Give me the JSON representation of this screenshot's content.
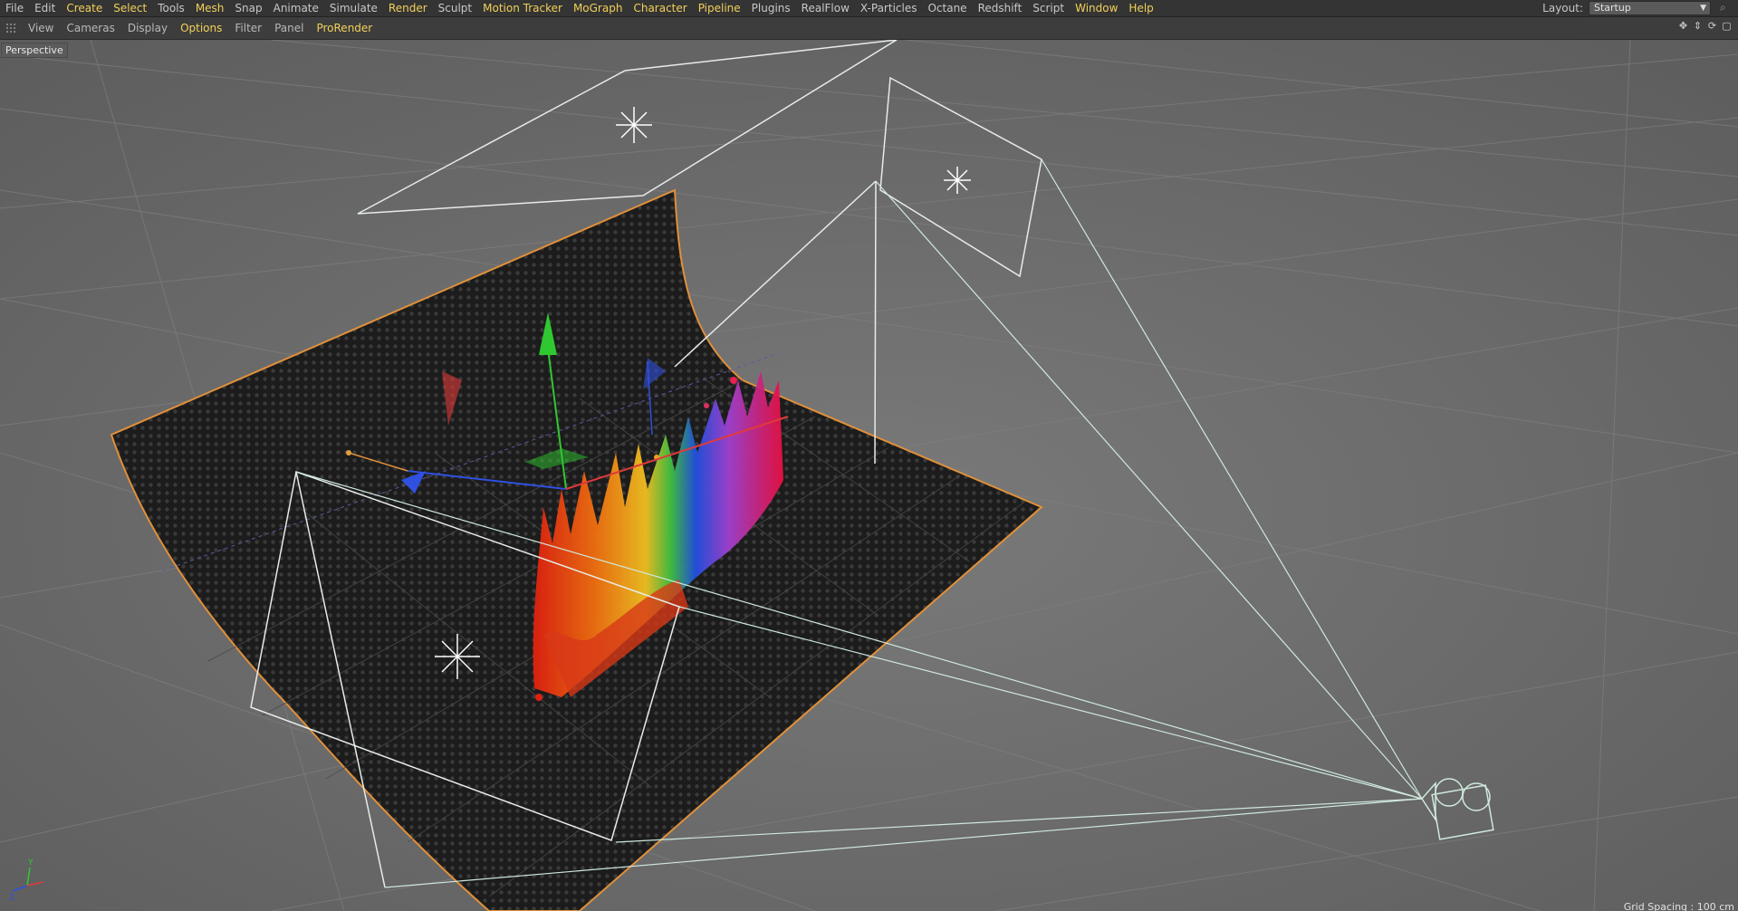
{
  "menubar": {
    "items": [
      {
        "label": "File",
        "hl": false
      },
      {
        "label": "Edit",
        "hl": false
      },
      {
        "label": "Create",
        "hl": true
      },
      {
        "label": "Select",
        "hl": true
      },
      {
        "label": "Tools",
        "hl": false
      },
      {
        "label": "Mesh",
        "hl": true
      },
      {
        "label": "Snap",
        "hl": false
      },
      {
        "label": "Animate",
        "hl": false
      },
      {
        "label": "Simulate",
        "hl": false
      },
      {
        "label": "Render",
        "hl": true
      },
      {
        "label": "Sculpt",
        "hl": false
      },
      {
        "label": "Motion Tracker",
        "hl": true
      },
      {
        "label": "MoGraph",
        "hl": true
      },
      {
        "label": "Character",
        "hl": true
      },
      {
        "label": "Pipeline",
        "hl": true
      },
      {
        "label": "Plugins",
        "hl": false
      },
      {
        "label": "RealFlow",
        "hl": false
      },
      {
        "label": "X-Particles",
        "hl": false
      },
      {
        "label": "Octane",
        "hl": false
      },
      {
        "label": "Redshift",
        "hl": false
      },
      {
        "label": "Script",
        "hl": false
      },
      {
        "label": "Window",
        "hl": true
      },
      {
        "label": "Help",
        "hl": true
      }
    ],
    "layout_label": "Layout:",
    "layout_value": "Startup"
  },
  "viewbar": {
    "items": [
      {
        "label": "View",
        "hl": false
      },
      {
        "label": "Cameras",
        "hl": false
      },
      {
        "label": "Display",
        "hl": false
      },
      {
        "label": "Options",
        "hl": true
      },
      {
        "label": "Filter",
        "hl": false
      },
      {
        "label": "Panel",
        "hl": false
      },
      {
        "label": "ProRender",
        "hl": true
      }
    ],
    "nav_icons": [
      "move-view-icon",
      "zoom-view-icon",
      "rotate-view-icon",
      "toggle-view-icon"
    ]
  },
  "viewport": {
    "label": "Perspective",
    "grid_spacing": "Grid Spacing : 100 cm",
    "colors": {
      "background": "#6c6c6c",
      "backdrop": "#1f1f1f",
      "backdrop_outline": "#e0903a",
      "wireframe": "#e6ece8",
      "axis_x": "#e03a3a",
      "axis_y": "#30c830",
      "axis_z": "#3050e0"
    },
    "icons": [
      "light-icon",
      "area-light-icon",
      "camera-icon",
      "move-gizmo-icon",
      "world-axis-icon"
    ]
  }
}
